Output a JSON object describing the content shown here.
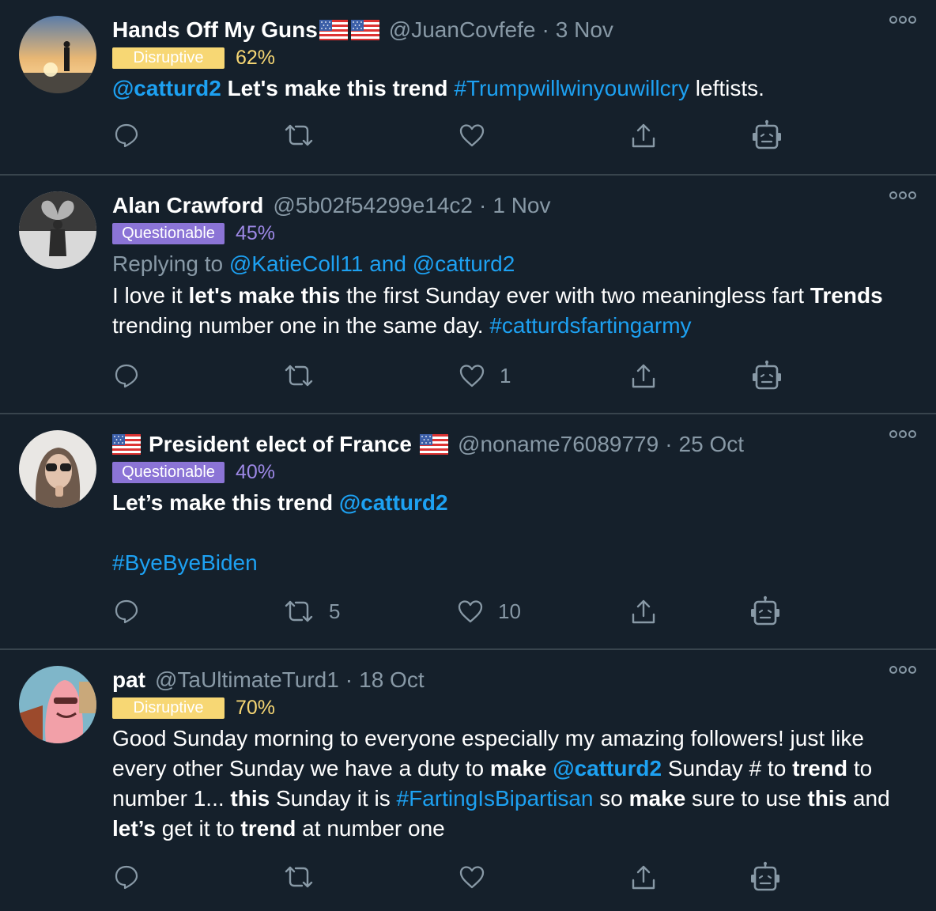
{
  "tweets": [
    {
      "name": "Hands Off My Guns",
      "handle": "@JuanCovfefe",
      "separator": "·",
      "date": "3 Nov",
      "badge": "Disruptive",
      "percent": "62%",
      "text_parts": [
        "@catturd2",
        " ",
        "Let's make this trend",
        " ",
        "#Trumpwillwinyouwillcry",
        " leftists."
      ],
      "reply_count": "",
      "retweet_count": "",
      "like_count": ""
    },
    {
      "name": "Alan Crawford",
      "handle": "@5b02f54299e14c2",
      "separator": "·",
      "date": "1 Nov",
      "badge": "Questionable",
      "percent": "45%",
      "replying_prefix": "Replying to ",
      "replying_users": "@KatieColl11 and @catturd2",
      "text_parts": [
        "I love it ",
        "let's make this",
        " the first Sunday ever with two meaningless fart ",
        "Trends",
        " trending number one in the same day. ",
        "#catturdsfartingarmy"
      ],
      "reply_count": "",
      "retweet_count": "",
      "like_count": "1"
    },
    {
      "name": "President elect of France",
      "handle": "@noname76089779",
      "separator": "·",
      "date": "25 Oct",
      "badge": "Questionable",
      "percent": "40%",
      "text_parts": [
        "Let’s make this trend",
        " ",
        "@catturd2",
        "#ByeByeBiden"
      ],
      "reply_count": "",
      "retweet_count": "5",
      "like_count": "10"
    },
    {
      "name": "pat",
      "handle": "@TaUltimateTurd1",
      "separator": "·",
      "date": "18 Oct",
      "badge": "Disruptive",
      "percent": "70%",
      "text_parts": [
        "Good Sunday morning to everyone especially my amazing followers! just like every other Sunday we have a duty to ",
        "make",
        " ",
        "@catturd2",
        " Sunday # to ",
        "trend",
        " to number 1... ",
        "this",
        " Sunday it is ",
        "#FartingIsBipartisan",
        " so ",
        "make",
        " sure to use ",
        "this",
        " and ",
        "let’s",
        " get it to ",
        "trend",
        " at number one"
      ],
      "reply_count": "",
      "retweet_count": "",
      "like_count": ""
    }
  ],
  "colors": {
    "background": "#15202b",
    "divider": "#38444d",
    "muted": "#8899a6",
    "link": "#1da1f2",
    "disruptive": "#f7d774",
    "questionable": "#8b74d6"
  },
  "icons": [
    "reply-icon",
    "retweet-icon",
    "like-icon",
    "share-icon",
    "bot-icon",
    "more-icon",
    "us-flag-icon"
  ]
}
